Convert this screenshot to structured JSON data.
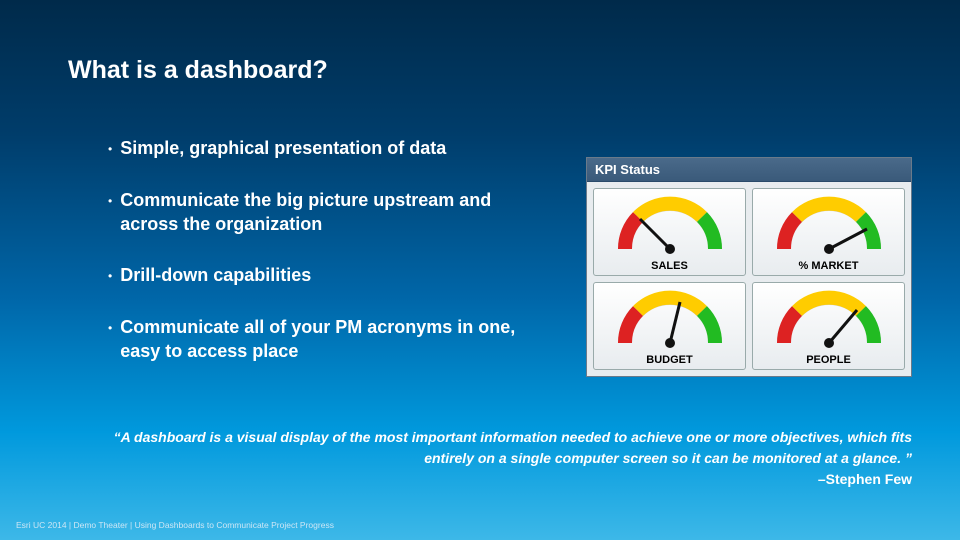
{
  "title": "What is a dashboard?",
  "bullets": [
    "Simple, graphical presentation of data",
    "Communicate the big picture upstream and across the organization",
    "Drill-down capabilities",
    "Communicate all of your PM acronyms in one, easy to access place"
  ],
  "kpi": {
    "header": "KPI Status",
    "cells": [
      {
        "label": "SALES"
      },
      {
        "label": "% MARKET"
      },
      {
        "label": "BUDGET"
      },
      {
        "label": "PEOPLE"
      }
    ]
  },
  "quote": {
    "text": "“A dashboard is a visual display of the most important information needed to achieve one or more objectives, which fits entirely on a single computer screen so it can be monitored at a glance. ”",
    "attribution": "–Stephen Few"
  },
  "footer": "Esri UC 2014 | Demo Theater | Using Dashboards to Communicate Project Progress"
}
